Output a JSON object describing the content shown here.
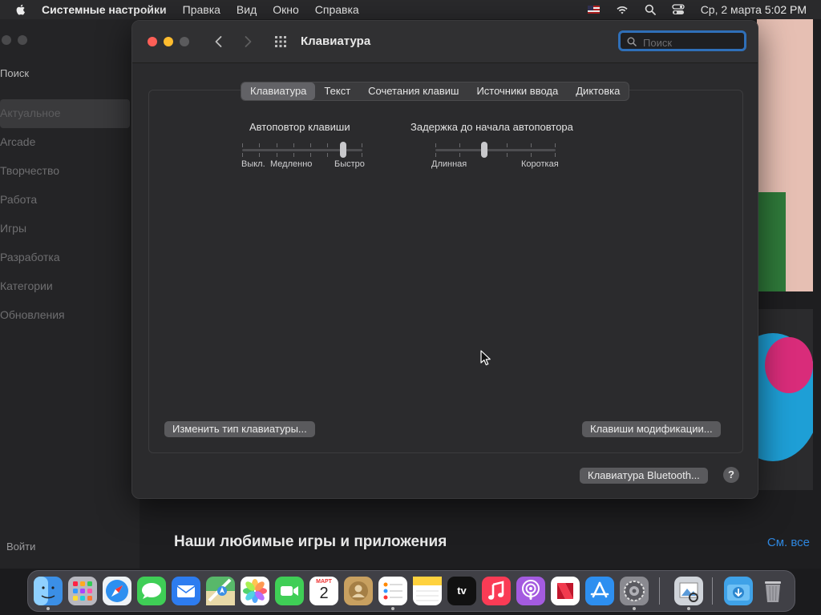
{
  "menubar": {
    "app_name": "Системные настройки",
    "items": [
      "Правка",
      "Вид",
      "Окно",
      "Справка"
    ],
    "datetime": "Ср, 2 марта  5:02 PM"
  },
  "background_app": {
    "search_label": "Поиск",
    "nav": [
      "Актуальное",
      "Arcade",
      "Творчество",
      "Работа",
      "Игры",
      "Разработка",
      "Категории",
      "Обновления"
    ],
    "login": "Войти",
    "section_title": "Наши любимые игры и приложения",
    "see_all": "См. все"
  },
  "window": {
    "title": "Клавиатура",
    "search_placeholder": "Поиск",
    "tabs": [
      "Клавиатура",
      "Текст",
      "Сочетания клавиш",
      "Источники ввода",
      "Диктовка"
    ],
    "active_tab": 0
  },
  "key_repeat": {
    "title": "Автоповтор клавиши",
    "labels": [
      "Выкл.",
      "Медленно",
      "Быстро"
    ],
    "tick_count": 8,
    "value_fraction": 0.86
  },
  "repeat_delay": {
    "title": "Задержка до начала автоповтора",
    "labels": [
      "Длинная",
      "Короткая"
    ],
    "tick_count": 6,
    "value_fraction": 0.4
  },
  "buttons": {
    "change_keyboard_type": "Изменить тип клавиатуры...",
    "modifier_keys": "Клавиши модификации...",
    "bluetooth_keyboard": "Клавиатура Bluetooth...",
    "help": "?"
  },
  "dock": {
    "calendar_month": "МАРТ",
    "calendar_day": "2",
    "tv_label": "tv",
    "icons": [
      "finder-icon",
      "launchpad-icon",
      "safari-icon",
      "messages-icon",
      "mail-icon",
      "maps-icon",
      "photos-icon",
      "facetime-icon",
      "calendar-icon",
      "contacts-icon",
      "reminders-icon",
      "notes-icon",
      "apple-tv-icon",
      "music-icon",
      "podcasts-icon",
      "news-icon",
      "app-store-icon",
      "system-preferences-icon",
      "preview-icon",
      "downloads-icon",
      "trash-icon"
    ],
    "colors": {
      "finder": "#3b8fe6",
      "launchpad": "#b8b8c0",
      "safari": "#2d8ff0",
      "messages": "#3fce56",
      "mail": "#2d7cf0",
      "maps": "#58b86a",
      "photos": "#ffffff",
      "facetime": "#3fce56",
      "calendar": "#ffffff",
      "contacts": "#c8a060",
      "reminders": "#ffffff",
      "notes": "#ffe066",
      "apple_tv": "#111111",
      "music": "#fa3b55",
      "podcasts": "#a45be0",
      "news": "#ffffff",
      "app_store": "#2d8ff0",
      "system_preferences": "#8a8a90",
      "preview": "#d0d4da",
      "downloads": "#3fa2e8",
      "trash": "#a0a0a6"
    }
  }
}
